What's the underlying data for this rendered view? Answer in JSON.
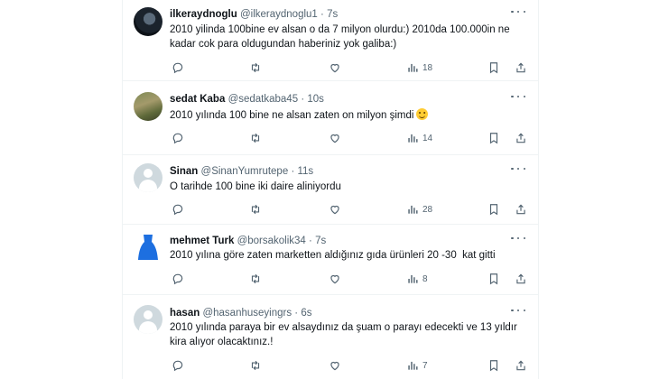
{
  "tweets": [
    {
      "name": "ilkeraydnoglu",
      "handle": "@ilkeraydnoglu1",
      "dot": "·",
      "time": "7s",
      "text": "2010 yilinda 100bine ev alsan o da 7 milyon olurdu:) 2010da 100.000in ne kadar cok para oldugundan haberiniz yok galiba:)",
      "views": "18",
      "avatar": "avatar-photo-dark"
    },
    {
      "name": "sedat Kaba",
      "handle": "@sedatkaba45",
      "dot": "·",
      "time": "10s",
      "text": "2010 yılında 100 bine ne alsan zaten on milyon şimdi",
      "emoji": "grinning-face",
      "views": "14",
      "avatar": "avatar-photo-outdoor"
    },
    {
      "name": "Sinan",
      "handle": "@SinanYumrutepe",
      "dot": "·",
      "time": "11s",
      "text": "O tarihde 100 bine iki daire aliniyordu",
      "views": "28",
      "avatar": "default-avatar"
    },
    {
      "name": "mehmet Turk",
      "handle": "@borsakolik34",
      "dot": "·",
      "time": "7s",
      "text": "2010 yılına göre zaten marketten aldığınız gıda ürünleri 20 -30  kat gitti",
      "views": "8",
      "avatar": "blue-shape-avatar"
    },
    {
      "name": "hasan",
      "handle": "@hasanhuseyingrs",
      "dot": "·",
      "time": "6s",
      "text": "2010 yılında paraya bir ev alsaydınız da şuam o parayı edecekti ve 13 yıldır kira alıyor olacaktınız.!",
      "views": "7",
      "avatar": "default-avatar"
    }
  ],
  "icons": {
    "reply": "reply-icon",
    "retweet": "retweet-icon",
    "like": "like-icon",
    "views": "views-icon",
    "bookmark": "bookmark-icon",
    "share": "share-icon",
    "more": "more-icon"
  },
  "colors": {
    "text": "#0f1419",
    "secondary": "#536471",
    "divider": "#eff3f4"
  }
}
